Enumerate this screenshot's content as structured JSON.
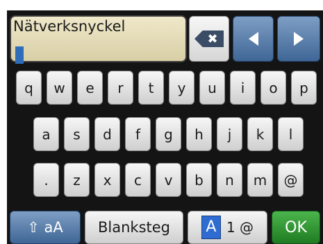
{
  "input": {
    "label": "Nätverksnyckel"
  },
  "controls": {
    "backspace_icon": "✖",
    "left_icon": "◀",
    "right_icon": "▶"
  },
  "rows": [
    [
      "q",
      "w",
      "e",
      "r",
      "t",
      "y",
      "u",
      "i",
      "o",
      "p"
    ],
    [
      "a",
      "s",
      "d",
      "f",
      "g",
      "h",
      "j",
      "k",
      "l"
    ],
    [
      ".",
      "z",
      "x",
      "c",
      "v",
      "b",
      "n",
      "m",
      "@"
    ]
  ],
  "bottom": {
    "shift_label": "⇧ aA",
    "space_label": "Blanksteg",
    "mode_active": "A",
    "mode_rest": "1 @",
    "ok_label": "OK"
  },
  "colors": {
    "accent_blue": "#3f6696",
    "ok_green": "#1f7b22",
    "input_bg": "#e5ddb8"
  }
}
